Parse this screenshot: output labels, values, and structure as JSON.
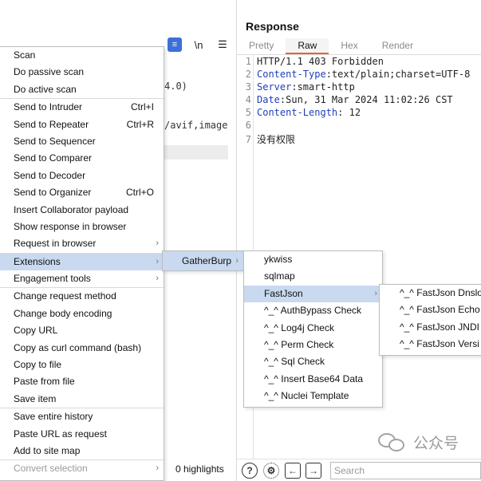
{
  "request": {
    "line_a": "4.0)",
    "line_b": "/avif,image"
  },
  "response": {
    "title": "Response",
    "tabs": [
      "Pretty",
      "Raw",
      "Hex",
      "Render"
    ],
    "active_tab": "Raw",
    "lines": [
      {
        "n": "1",
        "key": "",
        "text": "HTTP/1.1 403 Forbidden"
      },
      {
        "n": "2",
        "key": "Content-Type",
        "text": ":text/plain;charset=UTF-8"
      },
      {
        "n": "3",
        "key": "Server",
        "text": ":smart-http"
      },
      {
        "n": "4",
        "key": "Date",
        "text": ":Sun, 31 Mar 2024 11:02:26 CST"
      },
      {
        "n": "5",
        "key": "Content-Length",
        "text": ": 12"
      },
      {
        "n": "6",
        "key": "",
        "text": ""
      },
      {
        "n": "7",
        "key": "",
        "text": "没有权限"
      }
    ]
  },
  "bottom_bar": {
    "highlights": "0 highlights",
    "search_placeholder": "Search"
  },
  "context_menu": {
    "items": [
      {
        "label": "Scan"
      },
      {
        "label": "Do passive scan"
      },
      {
        "label": "Do active scan"
      },
      {
        "label": "Send to Intruder",
        "shortcut": "Ctrl+I"
      },
      {
        "label": "Send to Repeater",
        "shortcut": "Ctrl+R"
      },
      {
        "label": "Send to Sequencer"
      },
      {
        "label": "Send to Comparer"
      },
      {
        "label": "Send to Decoder"
      },
      {
        "label": "Send to Organizer",
        "shortcut": "Ctrl+O"
      },
      {
        "label": "Insert Collaborator payload"
      },
      {
        "label": "Show response in browser"
      },
      {
        "label": "Request in browser"
      },
      {
        "label": "Extensions"
      },
      {
        "label": "Engagement tools"
      },
      {
        "label": "Change request method"
      },
      {
        "label": "Change body encoding"
      },
      {
        "label": "Copy URL"
      },
      {
        "label": "Copy as curl command (bash)"
      },
      {
        "label": "Copy to file"
      },
      {
        "label": "Paste from file"
      },
      {
        "label": "Save item"
      },
      {
        "label": "Save entire history"
      },
      {
        "label": "Paste URL as request"
      },
      {
        "label": "Add to site map"
      },
      {
        "label": "Convert selection"
      }
    ]
  },
  "extensions_menu": {
    "items": [
      {
        "label": "GatherBurp"
      }
    ]
  },
  "gatherburp_menu": {
    "items": [
      {
        "label": "ykwiss"
      },
      {
        "label": "sqlmap"
      },
      {
        "label": "FastJson"
      },
      {
        "label": "^_^ AuthBypass Check"
      },
      {
        "label": "^_^ Log4j Check"
      },
      {
        "label": "^_^ Perm Check"
      },
      {
        "label": "^_^ Sql Check"
      },
      {
        "label": "^_^ Insert Base64 Data"
      },
      {
        "label": "^_^ Nuclei Template"
      }
    ]
  },
  "fastjson_menu": {
    "items": [
      {
        "label": "^_^ FastJson Dnslo"
      },
      {
        "label": "^_^ FastJson Echo"
      },
      {
        "label": "^_^ FastJson JNDI"
      },
      {
        "label": "^_^ FastJson Versi"
      }
    ]
  },
  "watermark": {
    "text": "公众号"
  }
}
